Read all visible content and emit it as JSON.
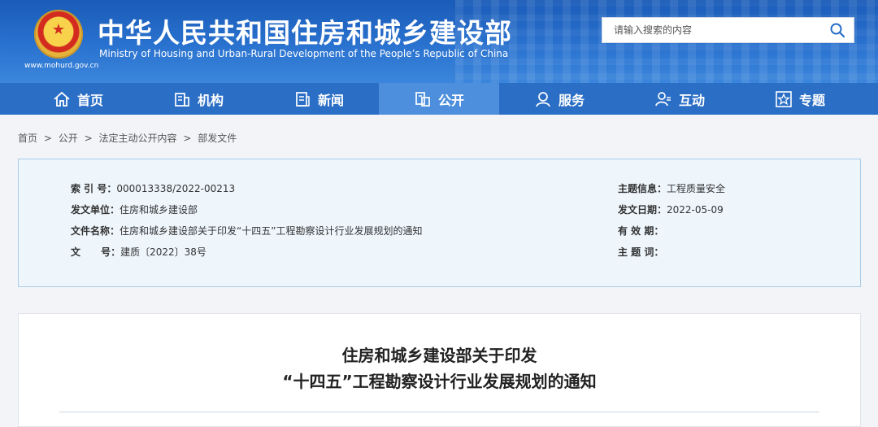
{
  "header": {
    "site_url": "www.mohurd.gov.cn",
    "title": "中华人民共和国住房和城乡建设部",
    "subtitle": "Ministry of Housing and Urban-Rural Development of the People’s Republic of China",
    "search": {
      "placeholder": "请输入搜索的内容",
      "icon": "search-icon"
    }
  },
  "nav": {
    "active_index": 3,
    "items": [
      {
        "label": "首页",
        "icon": "home-icon"
      },
      {
        "label": "机构",
        "icon": "building-icon"
      },
      {
        "label": "新闻",
        "icon": "news-icon"
      },
      {
        "label": "公开",
        "icon": "disclosure-icon"
      },
      {
        "label": "服务",
        "icon": "service-icon"
      },
      {
        "label": "互动",
        "icon": "interaction-icon"
      },
      {
        "label": "专题",
        "icon": "topic-star-icon"
      }
    ]
  },
  "breadcrumb": [
    "首页",
    ">",
    "公开",
    ">",
    "法定主动公开内容",
    ">",
    "部发文件"
  ],
  "info": {
    "index_label": "索  引  号：",
    "index_value": "000013338/2022-00213",
    "issuer_label": "发文单位：",
    "issuer_value": "住房和城乡建设部",
    "docname_label": "文件名称：",
    "docname_value": "住房和城乡建设部关于印发“十四五”工程勘察设计行业发展规划的通知",
    "docno_label": "文      号：",
    "docno_value": "建质〔2022〕38号",
    "topic_label": "主题信息：",
    "topic_value": "工程质量安全",
    "date_label": "发文日期：",
    "date_value": "2022-05-09",
    "validity_label": "有  效  期：",
    "validity_value": "",
    "keywords_label": "主  题  词：",
    "keywords_value": ""
  },
  "document": {
    "title_line1": "住房和城乡建设部关于印发",
    "title_line2": "“十四五”工程勘察设计行业发展规划的通知"
  },
  "colors": {
    "header_blue": "#2a6ec6",
    "active_tab": "#4d8fdc",
    "info_bg": "#eef6fc"
  }
}
